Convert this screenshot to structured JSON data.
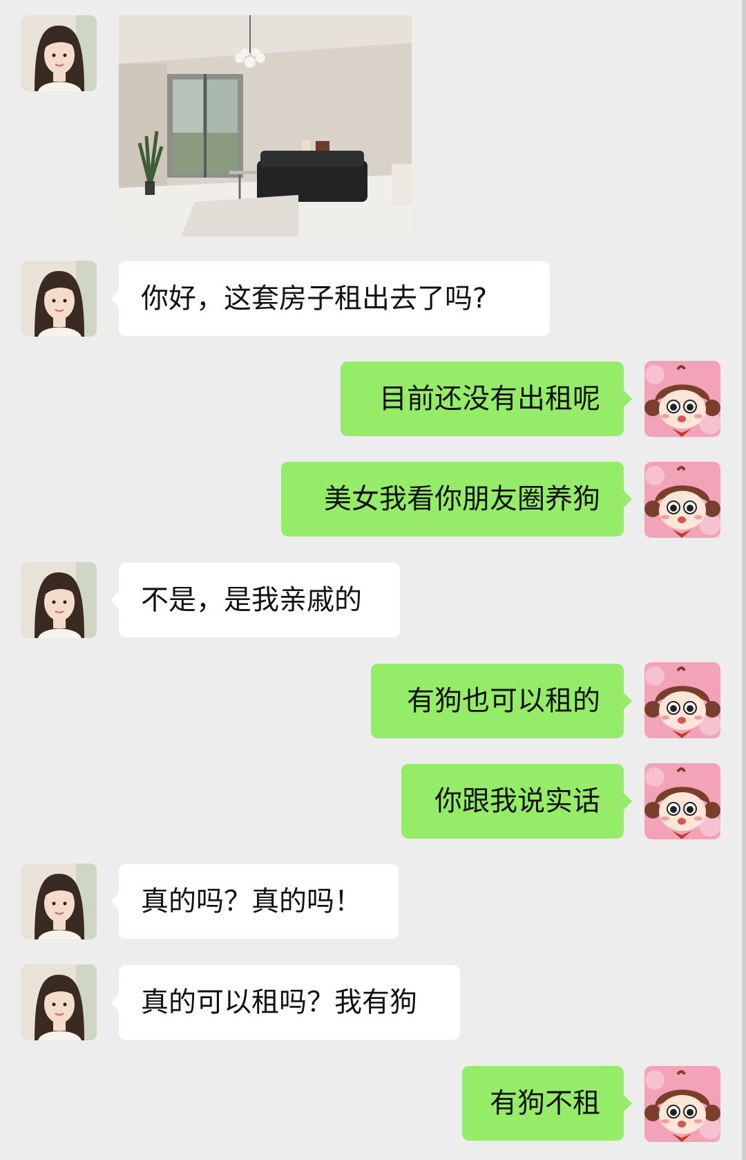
{
  "conversation": {
    "image_message": {
      "sender": "contact",
      "description": ""
    },
    "messages": [
      {
        "sender": "contact",
        "text": "你好，这套房子租出去了吗?"
      },
      {
        "sender": "me",
        "text": "目前还没有出租呢"
      },
      {
        "sender": "me",
        "text": "美女我看你朋友圈养狗"
      },
      {
        "sender": "contact",
        "text": "不是，是我亲戚的"
      },
      {
        "sender": "me",
        "text": "有狗也可以租的"
      },
      {
        "sender": "me",
        "text": "你跟我说实话"
      },
      {
        "sender": "contact",
        "text": "真的吗？真的吗！"
      },
      {
        "sender": "contact",
        "text": "真的可以租吗？我有狗"
      },
      {
        "sender": "me",
        "text": "有狗不租"
      }
    ]
  },
  "colors": {
    "background": "#ededed",
    "incoming_bubble": "#ffffff",
    "outgoing_bubble": "#95ec69",
    "text": "#111111"
  },
  "icons": {
    "contact_avatar": "woman-portrait-avatar",
    "my_avatar": "cartoon-girl-avatar",
    "shared_image": "living-room-photo"
  }
}
